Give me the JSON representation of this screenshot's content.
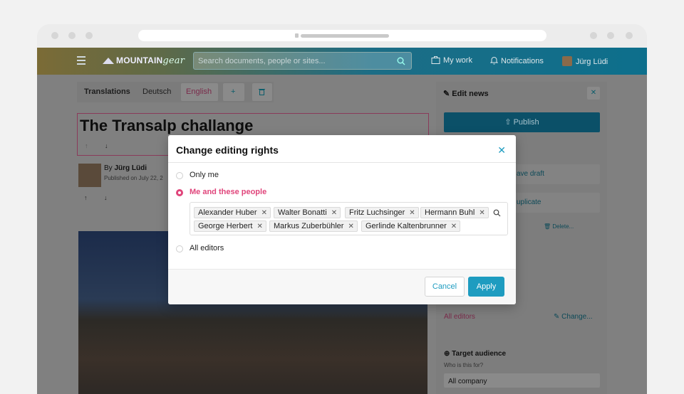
{
  "topbar": {
    "logo_bold": "MOUNTAIN",
    "logo_italic": "gear",
    "search_placeholder": "Search documents, people or sites...",
    "my_work": "My work",
    "notifications": "Notifications",
    "user_name": "Jürg Lüdi"
  },
  "editor": {
    "tabs_label": "Translations",
    "tab_de": "Deutsch",
    "tab_en": "English",
    "add": "+",
    "title": "The Transalp challange",
    "author_prefix": "By",
    "author_name": "Jürg Lüdi",
    "published": "Published on July 22, 2"
  },
  "sidebar": {
    "header": "Edit news",
    "publish": "Publish",
    "save_draft": "ave draft",
    "duplicate": "uplicate",
    "delete": "Delete...",
    "rights_value": "All editors",
    "change": "Change...",
    "target_title": "Target audience",
    "target_sub": "Who is this for?",
    "target_value": "All company"
  },
  "modal": {
    "title": "Change editing rights",
    "options": [
      {
        "label": "Only me",
        "selected": false
      },
      {
        "label": "Me and these people",
        "selected": true
      },
      {
        "label": "All editors",
        "selected": false
      }
    ],
    "people": [
      "Alexander Huber",
      "Walter Bonatti",
      "Fritz Luchsinger",
      "Hermann Buhl",
      "George Herbert",
      "Markus Zuberbühler",
      "Gerlinde Kaltenbrunner"
    ],
    "cancel": "Cancel",
    "apply": "Apply"
  },
  "colors": {
    "accent": "#1e9cc0",
    "selected": "#e0457b"
  }
}
